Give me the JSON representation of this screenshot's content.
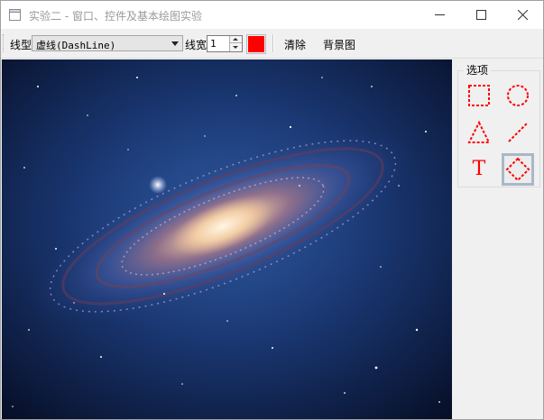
{
  "window": {
    "title": "实验二 - 窗口、控件及基本绘图实验",
    "buttons": [
      "minimize-icon",
      "maximize-icon",
      "close-icon"
    ]
  },
  "toolbar": {
    "line_style_label": "线型",
    "line_style_value": "虚线(DashLine)",
    "line_width_label": "线宽",
    "line_width_value": "1",
    "pen_color": "#ff0000",
    "clear_label": "清除",
    "background_label": "背景图"
  },
  "canvas": {
    "background_image": "galaxy"
  },
  "options": {
    "title": "选项",
    "tools": [
      {
        "name": "rectangle-tool",
        "icon": "dashed-rectangle-icon"
      },
      {
        "name": "ellipse-tool",
        "icon": "dashed-circle-icon"
      },
      {
        "name": "triangle-tool",
        "icon": "dashed-triangle-icon"
      },
      {
        "name": "line-tool",
        "icon": "dashed-line-icon"
      },
      {
        "name": "text-tool",
        "icon": "text-T-icon",
        "glyph": "T"
      },
      {
        "name": "diamond-tool",
        "icon": "dashed-diamond-icon",
        "selected": true
      }
    ],
    "accent_color": "#ff0000"
  }
}
